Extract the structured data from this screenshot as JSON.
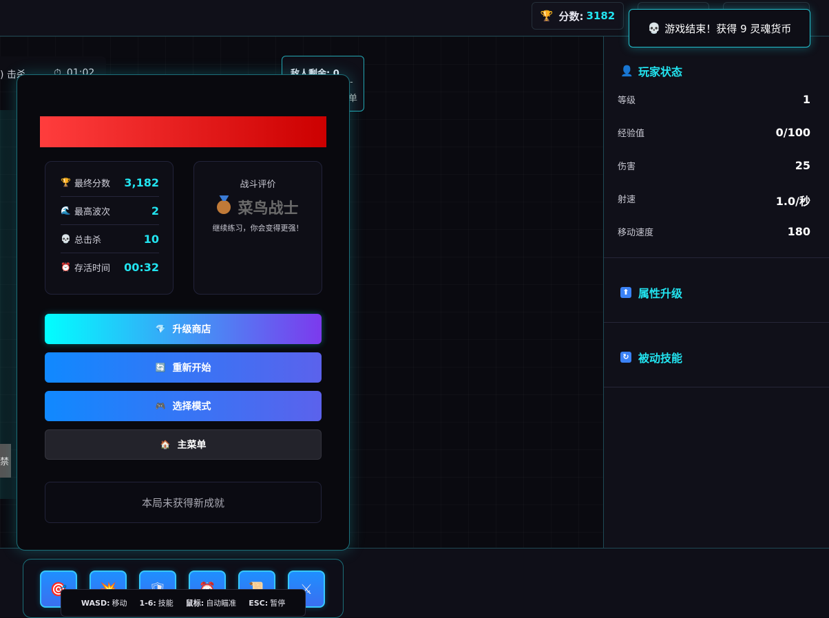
{
  "topbar": {
    "score_label": "分数:",
    "score_value": "3182"
  },
  "toast": {
    "text": "游戏结束！获得 9 灵魂货币",
    "icon": "skull-icon"
  },
  "hud": {
    "kills_partial": ") 击杀",
    "time_partial": "01:02",
    "enemy_label": "敌人剩余: 0",
    "enemy_side_a": "-",
    "enemy_side_b": "单",
    "left_chip": "禁"
  },
  "gameover": {
    "stats": [
      {
        "icon": "trophy-icon",
        "label": "最终分数",
        "value": "3,182"
      },
      {
        "icon": "wave-icon",
        "label": "最高波次",
        "value": "2"
      },
      {
        "icon": "skull-icon",
        "label": "总击杀",
        "value": "10"
      },
      {
        "icon": "alarm-icon",
        "label": "存活时间",
        "value": "00:32"
      }
    ],
    "rating": {
      "title": "战斗评价",
      "rank": "菜鸟战士",
      "desc": "继续练习，你会变得更强！"
    },
    "buttons": {
      "shop": "升级商店",
      "restart": "重新开始",
      "mode": "选择模式",
      "menu": "主菜单"
    },
    "achievements": "本局未获得新成就"
  },
  "panel": {
    "player_title": "玩家状态",
    "stats": [
      {
        "label": "等级",
        "value": "1"
      },
      {
        "label": "经验值",
        "value": "0/100"
      },
      {
        "label": "伤害",
        "value": "25"
      },
      {
        "label": "射速",
        "value": "1.0/秒"
      },
      {
        "label": "移动速度",
        "value": "180"
      }
    ],
    "upgrade_title": "属性升级",
    "passive_title": "被动技能"
  },
  "controls": [
    {
      "key": "WASD:",
      "action": "移动"
    },
    {
      "key": "1-6:",
      "action": "技能"
    },
    {
      "key": "鼠标:",
      "action": "自动瞄准"
    },
    {
      "key": "ESC:",
      "action": "暂停"
    }
  ],
  "colors": {
    "accent": "#22e4f0",
    "danger": "#ff3d3d",
    "primary": "#1089ff",
    "purple": "#7c3aed"
  }
}
